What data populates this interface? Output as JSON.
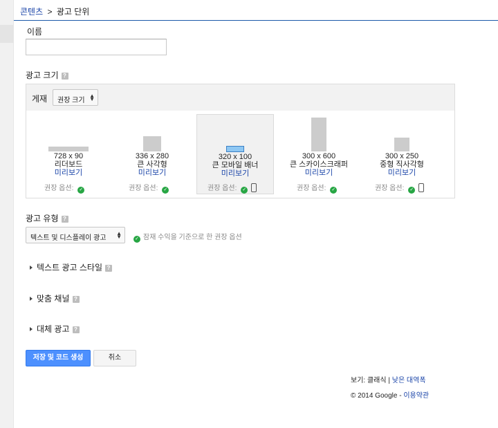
{
  "breadcrumb": {
    "parent": "콘텐츠",
    "separator": ">",
    "current": "광고 단위"
  },
  "name": {
    "label": "이름",
    "value": "",
    "placeholder": ""
  },
  "ad_size": {
    "label": "광고 크기",
    "help": "?",
    "publisher_label": "게재",
    "filter_value": "권장 크기",
    "recommended_label": "권장 옵션:",
    "cards": [
      {
        "dims": "728 x 90",
        "name": "리더보드",
        "preview": "미리보기",
        "mobile": false,
        "selected": false
      },
      {
        "dims": "336 x 280",
        "name": "큰 사각형",
        "preview": "미리보기",
        "mobile": false,
        "selected": false
      },
      {
        "dims": "320 x 100",
        "name": "큰 모바일 배너",
        "preview": "미리보기",
        "mobile": true,
        "selected": true
      },
      {
        "dims": "300 x 600",
        "name": "큰 스카이스크래퍼",
        "preview": "미리보기",
        "mobile": false,
        "selected": false
      },
      {
        "dims": "300 x 250",
        "name": "중형 직사각형",
        "preview": "미리보기",
        "mobile": true,
        "selected": false
      }
    ]
  },
  "ad_type": {
    "label": "광고 유형",
    "help": "?",
    "value": "텍스트 및 디스플레이 광고",
    "note": "잠재 수익을 기준으로 한 권장 옵션"
  },
  "sections": {
    "text_style": "텍스트 광고 스타일",
    "custom_channels": "맞춤 채널",
    "backup_ads": "대체 광고"
  },
  "buttons": {
    "save": "저장 및 코드 생성",
    "cancel": "취소"
  },
  "footer": {
    "view_prefix": "보기:",
    "view_classic": "클래식",
    "view_sep": "|",
    "view_low_bandwidth": "낮은 대역폭",
    "copyright": "© 2014 Google -",
    "terms": "이용약관"
  },
  "colors": {
    "link": "#1a44a8",
    "primary_button": "#4d90fe",
    "check": "#27a644",
    "rule": "#1a58a8"
  },
  "icons": {
    "help": "question-square-icon",
    "check": "check-circle-icon",
    "mobile": "mobile-phone-icon",
    "expand": "triangle-right-icon",
    "select": "up-down-arrows-icon"
  }
}
